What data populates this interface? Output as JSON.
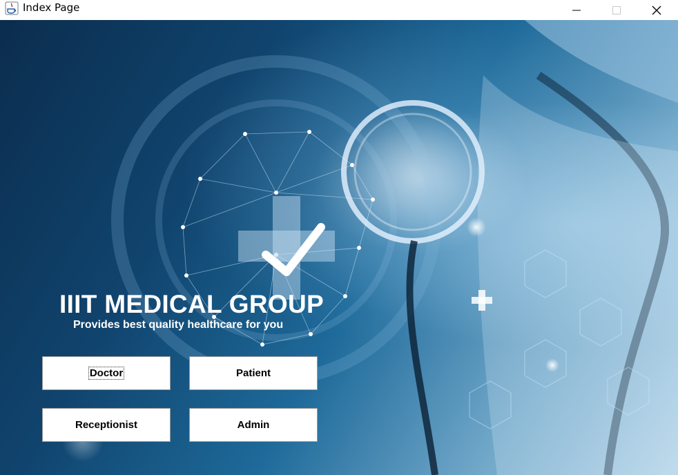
{
  "window": {
    "title": "Index Page",
    "controls": {
      "minimize_icon": "minimize-icon",
      "maximize_icon": "maximize-icon",
      "close_icon": "close-icon"
    }
  },
  "hero": {
    "heading": "IIIT MEDICAL GROUP",
    "subheading": "Provides best quality healthcare for you",
    "background_image": "doctor-stethoscope-medical-network"
  },
  "buttons": {
    "doctor": "Doctor",
    "patient": "Patient",
    "receptionist": "Receptionist",
    "admin": "Admin"
  },
  "colors": {
    "background_dark": "#0b2d4e",
    "background_light": "#b9d6ea",
    "heading": "#ffffff",
    "button_bg": "#ffffff"
  }
}
